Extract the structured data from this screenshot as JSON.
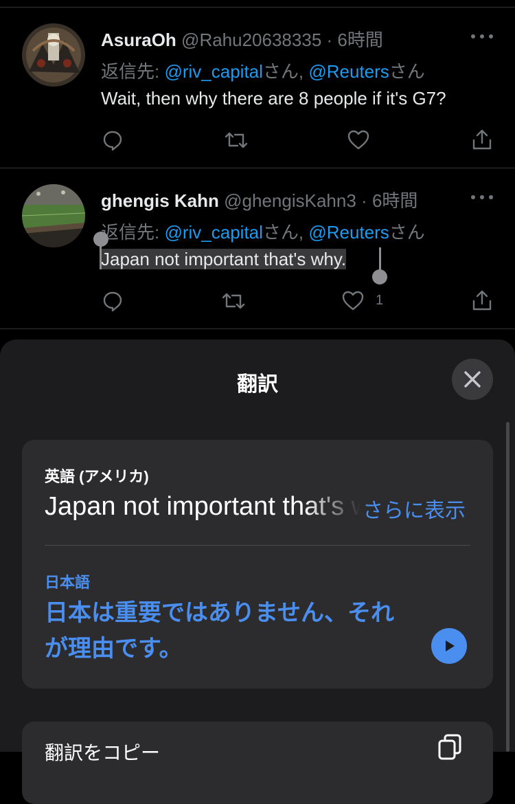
{
  "tweets": [
    {
      "name": "AsuraOh",
      "handle": "@Rahu20638335",
      "separator": "·",
      "time": "6時間",
      "reply_prefix": "返信先: ",
      "reply_to_1": "@riv_capital",
      "reply_suffix_1": "さん, ",
      "reply_to_2": "@Reuters",
      "reply_suffix_2": "さん",
      "text": "Wait, then why there are 8 people if it's G7?",
      "like_count": ""
    },
    {
      "name": "ghengis Kahn",
      "handle": "@ghengisKahn3",
      "separator": "·",
      "time": "6時間",
      "reply_prefix": "返信先: ",
      "reply_to_1": "@riv_capital",
      "reply_suffix_1": "さん, ",
      "reply_to_2": "@Reuters",
      "reply_suffix_2": "さん",
      "text": "Japan not important that's why.",
      "like_count": "1"
    }
  ],
  "translation_sheet": {
    "title": "翻訳",
    "source_language": "英語 (アメリカ)",
    "source_text": "Japan not important that's why.",
    "show_more": "さらに表示",
    "target_language": "日本語",
    "target_text": "日本は重要ではありません、それが理由です。",
    "next_card_label": "翻訳をコピー"
  },
  "icons": {
    "reply": "reply-icon",
    "retweet": "retweet-icon",
    "like": "heart-icon",
    "share": "share-icon",
    "more": "more-dots-icon",
    "close": "close-icon",
    "play": "play-icon",
    "copy": "copy-icon"
  },
  "colors": {
    "background": "#000000",
    "link": "#1d9bf0",
    "sheet": "#1c1c1e",
    "card": "#2c2c2e",
    "translation_accent": "#4a8ff0"
  }
}
